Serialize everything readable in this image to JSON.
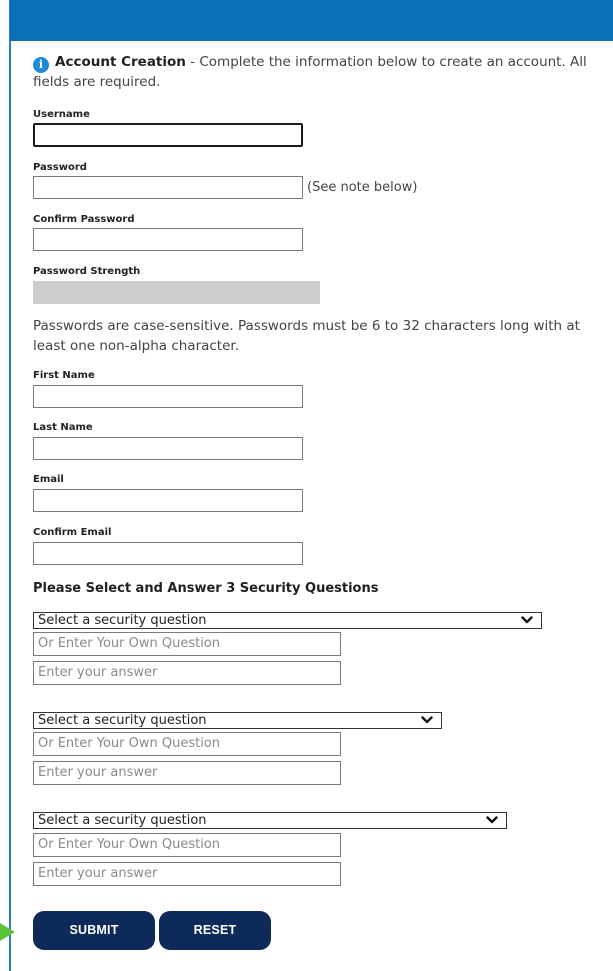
{
  "intro": {
    "title": "Account Creation",
    "text": " - Complete the information below to create an account. All fields are required."
  },
  "fields": {
    "username": {
      "label": "Username",
      "value": ""
    },
    "password": {
      "label": "Password",
      "value": "",
      "note": "(See note below)"
    },
    "confirm_password": {
      "label": "Confirm Password",
      "value": ""
    },
    "password_strength": {
      "label": "Password Strength"
    },
    "first_name": {
      "label": "First Name",
      "value": ""
    },
    "last_name": {
      "label": "Last Name",
      "value": ""
    },
    "email": {
      "label": "Email",
      "value": ""
    },
    "confirm_email": {
      "label": "Confirm Email",
      "value": ""
    }
  },
  "password_note": "Passwords are case-sensitive. Passwords must be 6 to 32 characters long with at least one non-alpha character.",
  "security": {
    "heading": "Please Select and Answer 3 Security Questions",
    "questions": [
      {
        "select": "Select a security question",
        "own_placeholder": "Or Enter Your Own Question",
        "answer_placeholder": "Enter your answer"
      },
      {
        "select": "Select a security question",
        "own_placeholder": "Or Enter Your Own Question",
        "answer_placeholder": "Enter your answer"
      },
      {
        "select": "Select a security question",
        "own_placeholder": "Or Enter Your Own Question",
        "answer_placeholder": "Enter your answer"
      }
    ]
  },
  "buttons": {
    "submit": "SUBMIT",
    "reset": "RESET"
  },
  "icons": {
    "info": "info-icon",
    "chevron": "chevron-down-icon",
    "pointer": "arrow-pointer-icon"
  },
  "colors": {
    "header": "#0a70b8",
    "button": "#0d2a5a",
    "info_icon": "#1f8ad6",
    "strength_bar": "#cccccc",
    "arrow": "#5ec23a"
  }
}
